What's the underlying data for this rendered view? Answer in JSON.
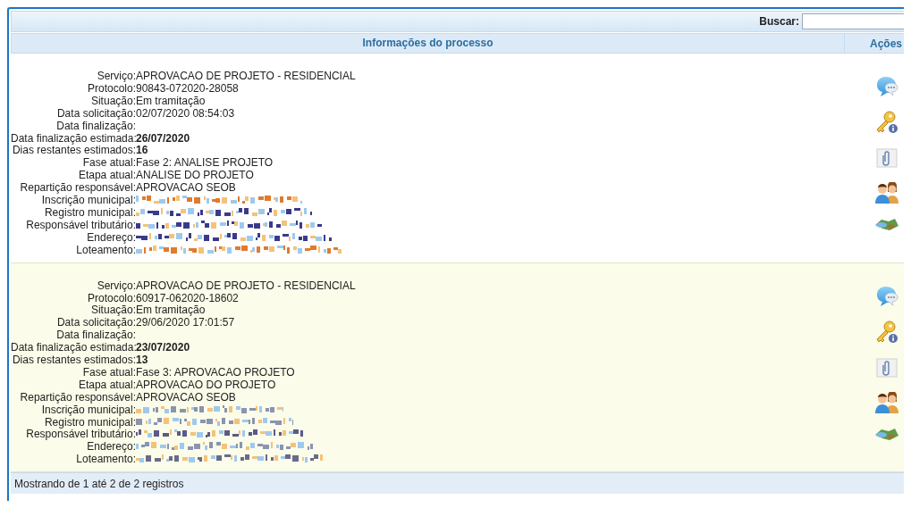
{
  "search": {
    "label": "Buscar:"
  },
  "table": {
    "columns": [
      "Informações do processo",
      "Ações"
    ],
    "rows": [
      {
        "fields": [
          {
            "label": "Serviço:",
            "kind": "text",
            "value": "APROVACAO DE PROJETO - RESIDENCIAL",
            "bold": false
          },
          {
            "label": "Protocolo:",
            "kind": "text",
            "value": "90843-072020-28058",
            "bold": false
          },
          {
            "label": "Situação:",
            "kind": "text",
            "value": "Em tramitação",
            "bold": false
          },
          {
            "label": "Data solicitação:",
            "kind": "text",
            "value": "02/07/2020 08:54:03",
            "bold": false
          },
          {
            "label": "Data finalização:",
            "kind": "empty"
          },
          {
            "label": "Data finalização estimada:",
            "kind": "text",
            "value": "26/07/2020",
            "bold": true
          },
          {
            "label": "Dias restantes estimados:",
            "kind": "text",
            "value": "16",
            "bold": true
          },
          {
            "label": "Fase atual:",
            "kind": "text",
            "value": "Fase 2: ANALISE PROJETO",
            "bold": false
          },
          {
            "label": "Etapa atual:",
            "kind": "text",
            "value": "ANALISE DO PROJETO",
            "bold": false
          },
          {
            "label": "Repartição responsável:",
            "kind": "text",
            "value": "APROVACAO SEOB",
            "bold": false
          },
          {
            "label": "Inscrição municipal:",
            "kind": "redacted",
            "color": "#e07a30"
          },
          {
            "label": "Registro municipal:",
            "kind": "redacted",
            "color": "#3a3a8a"
          },
          {
            "label": "Responsável tributário:",
            "kind": "redacted",
            "color": "#3a3a8a"
          },
          {
            "label": "Endereço:",
            "kind": "redacted",
            "color": "#3a3a8a"
          },
          {
            "label": "Loteamento:",
            "kind": "redacted",
            "color": "#e07a30"
          }
        ],
        "actions": [
          {
            "kind": "chat"
          },
          {
            "kind": "key"
          },
          {
            "kind": "attachment"
          },
          {
            "kind": "people"
          },
          {
            "kind": "map"
          }
        ]
      },
      {
        "fields": [
          {
            "label": "Serviço:",
            "kind": "text",
            "value": "APROVACAO DE PROJETO - RESIDENCIAL",
            "bold": false
          },
          {
            "label": "Protocolo:",
            "kind": "text",
            "value": "60917-062020-18602",
            "bold": false
          },
          {
            "label": "Situação:",
            "kind": "text",
            "value": "Em tramitação",
            "bold": false
          },
          {
            "label": "Data solicitação:",
            "kind": "text",
            "value": "29/06/2020 17:01:57",
            "bold": false
          },
          {
            "label": "Data finalização:",
            "kind": "empty"
          },
          {
            "label": "Data finalização estimada:",
            "kind": "text",
            "value": "23/07/2020",
            "bold": true
          },
          {
            "label": "Dias restantes estimados:",
            "kind": "text",
            "value": "13",
            "bold": true
          },
          {
            "label": "Fase atual:",
            "kind": "text",
            "value": "Fase 3: APROVACAO PROJETO",
            "bold": false
          },
          {
            "label": "Etapa atual:",
            "kind": "text",
            "value": "APROVACAO DO PROJETO",
            "bold": false
          },
          {
            "label": "Repartição responsável:",
            "kind": "text",
            "value": "APROVACAO SEOB",
            "bold": false
          },
          {
            "label": "Inscrição municipal:",
            "kind": "redacted",
            "color": "#8a94b0"
          },
          {
            "label": "Registro municipal:",
            "kind": "redacted",
            "color": "#8a94b0"
          },
          {
            "label": "Responsável tributário:",
            "kind": "redacted",
            "color": "#5a5a8a"
          },
          {
            "label": "Endereço:",
            "kind": "redacted",
            "color": "#8a94b0"
          },
          {
            "label": "Loteamento:",
            "kind": "redacted",
            "color": "#6a6a8a"
          }
        ],
        "actions": [
          {
            "kind": "chat"
          },
          {
            "kind": "key"
          },
          {
            "kind": "attachment"
          },
          {
            "kind": "people"
          },
          {
            "kind": "map"
          }
        ]
      }
    ]
  },
  "footer": "Mostrando de 1 até 2 de 2 registros"
}
